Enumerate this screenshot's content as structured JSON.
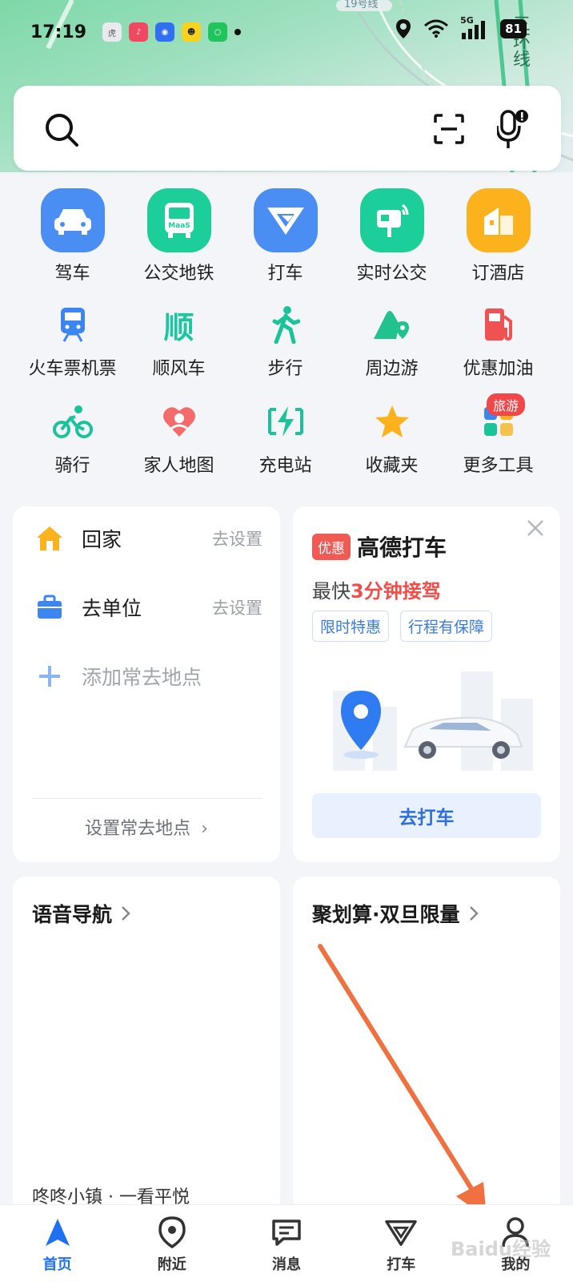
{
  "status_bar": {
    "time": "17:19",
    "battery": "81",
    "network": "5G"
  },
  "map": {
    "road_label": "三环线",
    "line_label": "19号线"
  },
  "search": {
    "placeholder": ""
  },
  "tools": {
    "row1": [
      {
        "label": "驾车",
        "icon": "car-icon",
        "color": "#4a8df3"
      },
      {
        "label": "公交地铁",
        "icon": "bus-icon",
        "color": "#1ccf9a"
      },
      {
        "label": "打车",
        "icon": "taxi-icon",
        "color": "#4a8df3"
      },
      {
        "label": "实时公交",
        "icon": "bus-stop-icon",
        "color": "#1ccf9a"
      },
      {
        "label": "订酒店",
        "icon": "hotel-icon",
        "color": "#fbb21c"
      }
    ],
    "row2": [
      {
        "label": "火车票机票",
        "icon": "train-icon"
      },
      {
        "label": "顺风车",
        "icon": "carpool-icon",
        "glyph": "顺"
      },
      {
        "label": "步行",
        "icon": "walk-icon"
      },
      {
        "label": "周边游",
        "icon": "nearby-trip-icon"
      },
      {
        "label": "优惠加油",
        "icon": "fuel-icon"
      }
    ],
    "row3": [
      {
        "label": "骑行",
        "icon": "bike-icon"
      },
      {
        "label": "家人地图",
        "icon": "family-map-icon"
      },
      {
        "label": "充电站",
        "icon": "charging-icon"
      },
      {
        "label": "收藏夹",
        "icon": "star-icon"
      },
      {
        "label": "更多工具",
        "icon": "more-tools-icon",
        "badge": "旅游"
      }
    ]
  },
  "home_card": {
    "home_label": "回家",
    "home_action": "去设置",
    "work_label": "去单位",
    "work_action": "去设置",
    "add_label": "添加常去地点",
    "footer": "设置常去地点"
  },
  "taxi_card": {
    "tag": "优惠",
    "title": "高德打车",
    "sub_prefix": "最快",
    "sub_highlight": "3分钟接驾",
    "tags": [
      "限时特惠",
      "行程有保障"
    ],
    "button": "去打车"
  },
  "voice_card": {
    "title": "语音导航",
    "bottom_text": " 咚咚小镇 · 一看平悦"
  },
  "deal_card": {
    "title": "聚划算·双旦限量"
  },
  "bottom_nav": [
    {
      "label": "首页",
      "icon": "home-nav-icon",
      "active": true
    },
    {
      "label": "附近",
      "icon": "nearby-nav-icon",
      "active": false
    },
    {
      "label": "消息",
      "icon": "message-nav-icon",
      "active": false
    },
    {
      "label": "打车",
      "icon": "taxi-nav-icon",
      "active": false
    },
    {
      "label": "我的",
      "icon": "profile-nav-icon",
      "active": false
    }
  ],
  "watermark": "Baidu经验",
  "colors": {
    "accent": "#1f6ff2",
    "promo_red": "#ef4f4a",
    "annotation": "#f07040"
  }
}
